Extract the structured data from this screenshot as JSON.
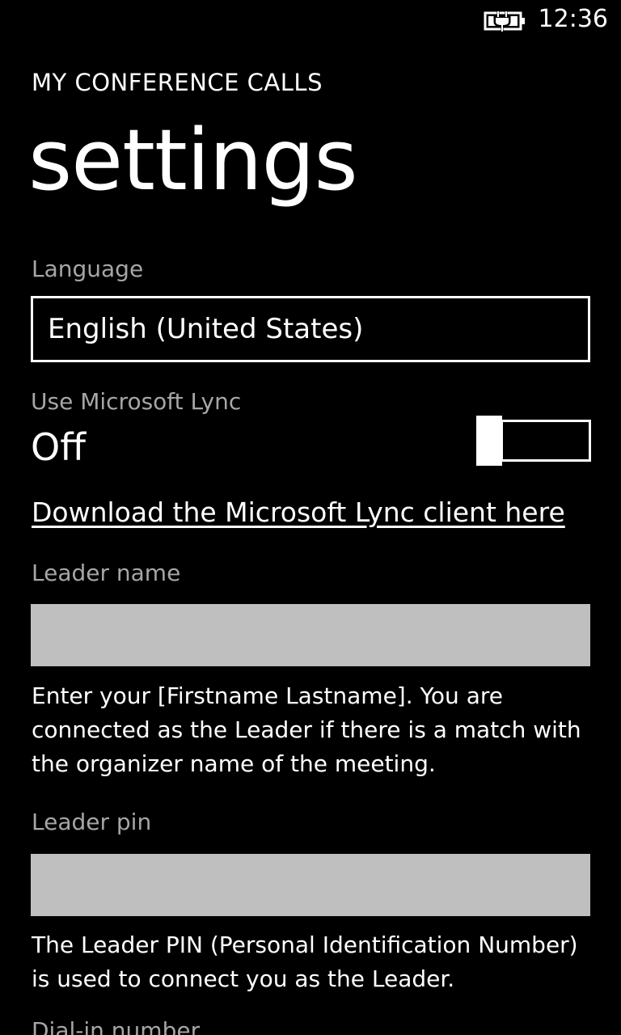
{
  "status_bar": {
    "battery_icon": "battery-charging-icon",
    "time": "12:36"
  },
  "header": {
    "app_title": "MY CONFERENCE CALLS",
    "page_title": "settings"
  },
  "language": {
    "label": "Language",
    "value": "English (United States)"
  },
  "lync": {
    "label": "Use Microsoft Lync",
    "state": "Off",
    "enabled": false,
    "download_link": "Download the Microsoft Lync client here"
  },
  "leader_name": {
    "label": "Leader name",
    "value": "",
    "help": "Enter your [Firstname Lastname]. You are connected as the Leader if there is a match with the organizer name of the meeting."
  },
  "leader_pin": {
    "label": "Leader pin",
    "value": "",
    "help": "The Leader PIN (Personal Identification Number) is used to connect you as the Leader."
  },
  "dial_in": {
    "label": "Dial-in number"
  },
  "colors": {
    "background": "#000000",
    "foreground": "#ffffff",
    "label": "#a6a6a6",
    "textbox": "#bfbfbf"
  }
}
